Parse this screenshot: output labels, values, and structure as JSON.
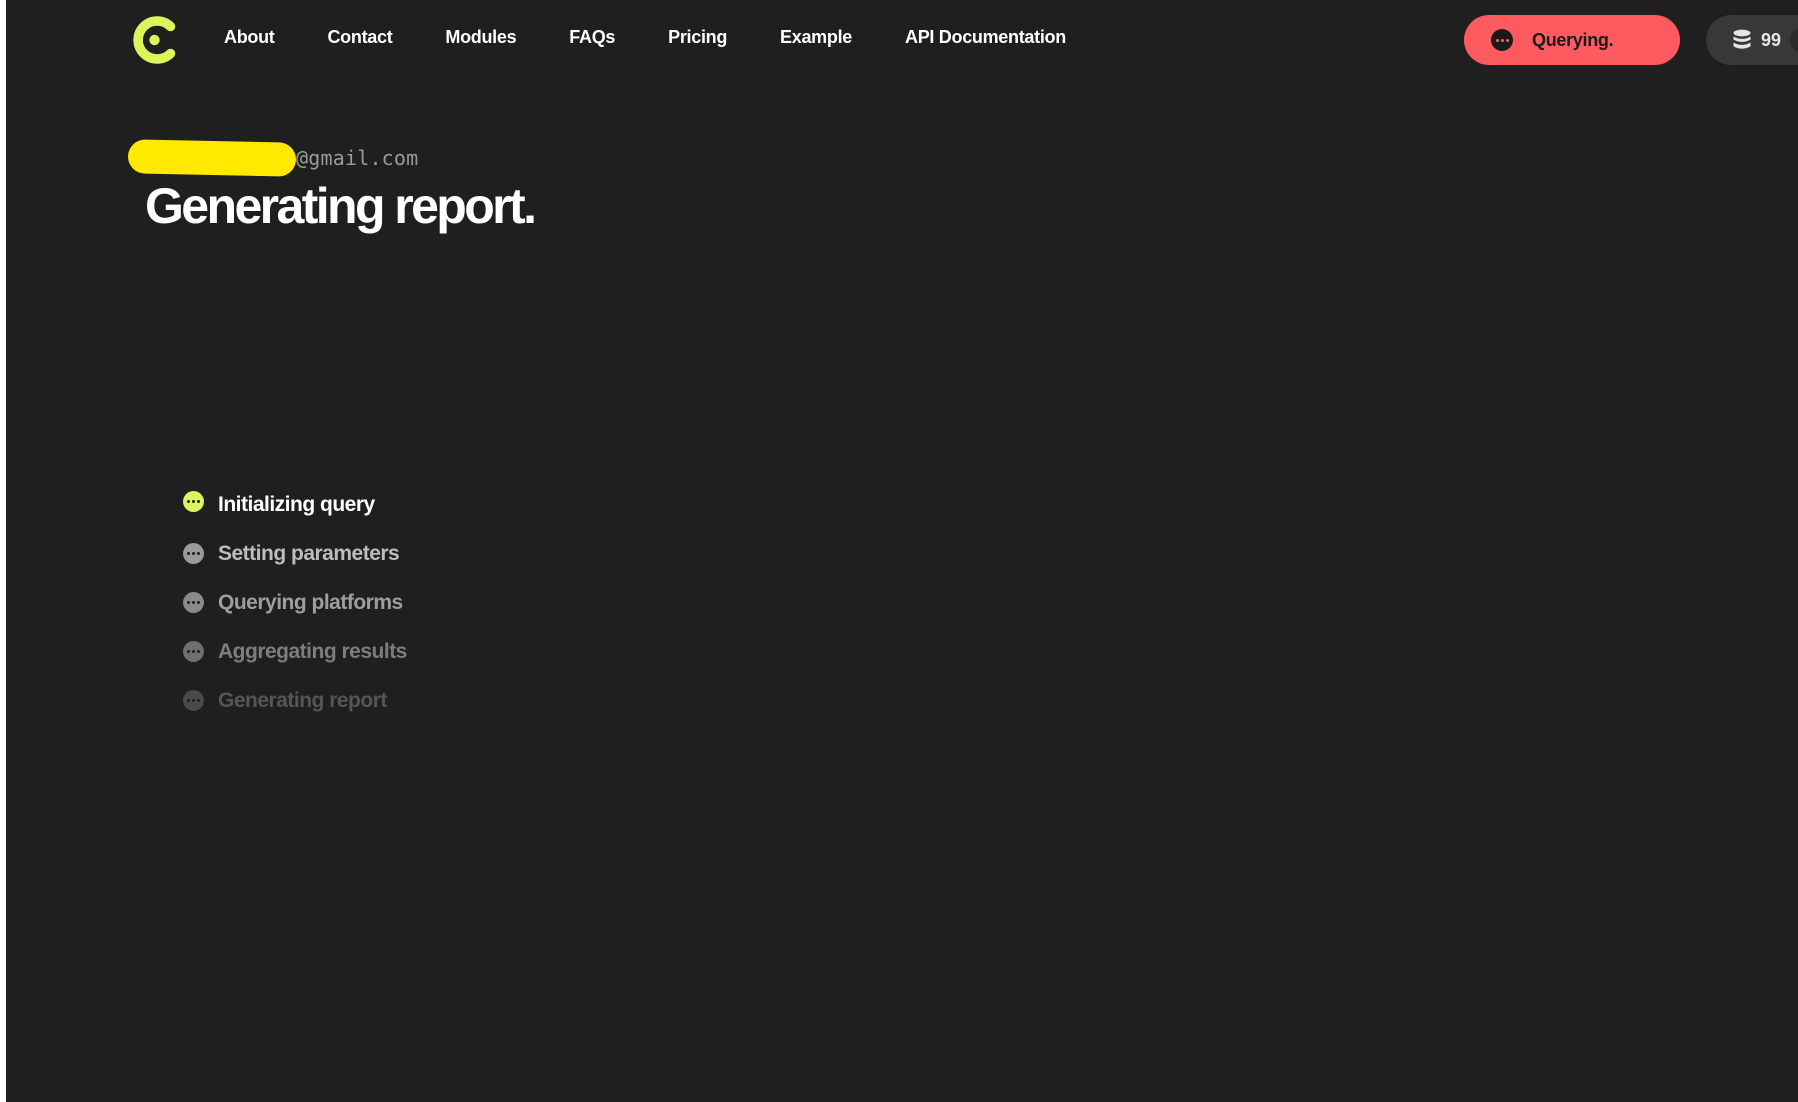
{
  "nav": {
    "items": [
      {
        "label": "About"
      },
      {
        "label": "Contact"
      },
      {
        "label": "Modules"
      },
      {
        "label": "FAQs"
      },
      {
        "label": "Pricing"
      },
      {
        "label": "Example"
      },
      {
        "label": "API Documentation"
      }
    ]
  },
  "status": {
    "label": "Querying.",
    "color": "#ff5a5f"
  },
  "credits": {
    "count": "99",
    "icon": "database-icon"
  },
  "header": {
    "email_suffix": "@gmail.com",
    "title": "Generating report."
  },
  "steps": [
    {
      "label": "Initializing query",
      "state": "active"
    },
    {
      "label": "Setting parameters",
      "state": "pending"
    },
    {
      "label": "Querying platforms",
      "state": "pending"
    },
    {
      "label": "Aggregating results",
      "state": "pending"
    },
    {
      "label": "Generating report",
      "state": "pending"
    }
  ],
  "colors": {
    "background": "#1f1f1f",
    "accent": "#dcf55a",
    "redaction": "#ffe900"
  }
}
